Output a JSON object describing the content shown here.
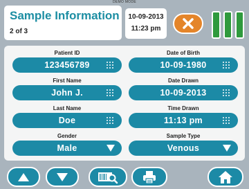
{
  "demo_label": "DEMO MODE",
  "header": {
    "title": "Sample Information",
    "page": "2 of 3",
    "date": "10-09-2013",
    "time": "11:23 pm",
    "cancel_icon": "close-x-icon",
    "colors": {
      "accent": "#1d8ea3",
      "cancel": "#e4852a",
      "tube": "#2f9a3d"
    }
  },
  "fields": {
    "patient_id": {
      "label": "Patient ID",
      "value": "123456789",
      "icon": "keypad-icon"
    },
    "dob": {
      "label": "Date of Birth",
      "value": "10-09-1980",
      "icon": "keypad-icon"
    },
    "first_name": {
      "label": "First Name",
      "value": "John J.",
      "icon": "keypad-icon"
    },
    "date_drawn": {
      "label": "Date Drawn",
      "value": "10-09-2013",
      "icon": "keypad-icon"
    },
    "last_name": {
      "label": "Last Name",
      "value": "Doe",
      "icon": "keypad-icon"
    },
    "time_drawn": {
      "label": "Time Drawn",
      "value": "11:13 pm",
      "icon": "keypad-icon"
    },
    "gender": {
      "label": "Gender",
      "value": "Male",
      "icon": "dropdown-arrow-icon"
    },
    "sample_type": {
      "label": "Sample Type",
      "value": "Venous",
      "icon": "dropdown-arrow-icon"
    }
  },
  "toolbar": {
    "up_icon": "arrow-up-icon",
    "down_icon": "arrow-down-icon",
    "scan_icon": "barcode-scan-icon",
    "print_icon": "printer-icon",
    "home_icon": "home-icon"
  }
}
